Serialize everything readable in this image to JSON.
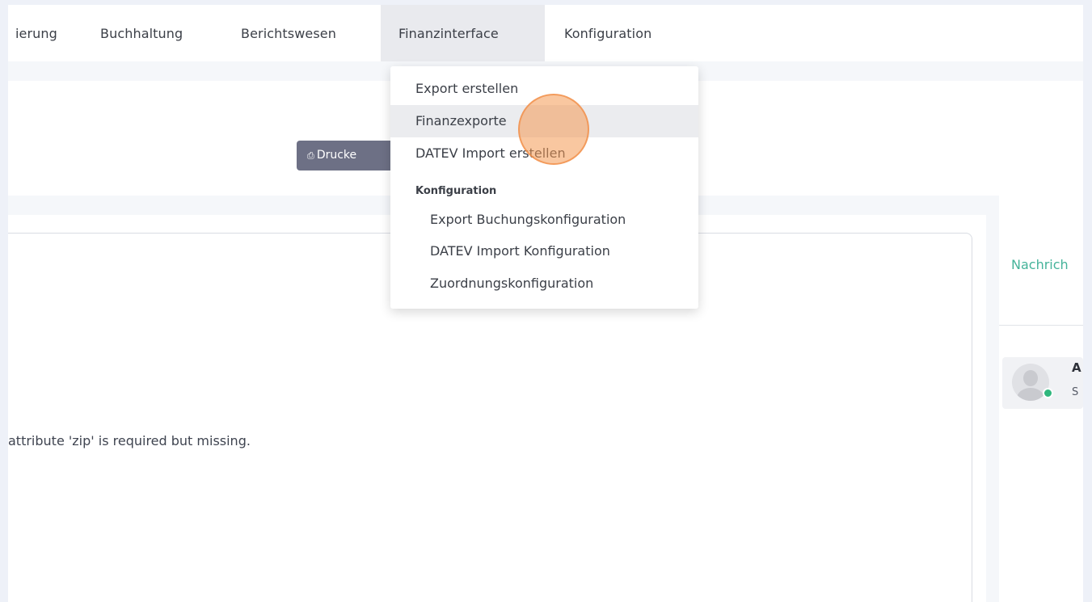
{
  "topnav": {
    "items": [
      {
        "label": "ierung"
      },
      {
        "label": "Buchhaltung"
      },
      {
        "label": "Berichtswesen"
      },
      {
        "label": "Finanzinterface"
      },
      {
        "label": "Konfiguration"
      }
    ],
    "active_index": 3
  },
  "header": {
    "print_button": {
      "label": "Drucke",
      "icon": "printer-icon"
    }
  },
  "main": {
    "error_message": "attribute 'zip' is required but missing."
  },
  "sidebar": {
    "messages_link": "Nachrich",
    "user": {
      "initial": "A",
      "subtitle": "S",
      "status": "online",
      "status_color": "#2fb77d"
    }
  },
  "dropdown": {
    "items": [
      {
        "label": "Export erstellen"
      },
      {
        "label": "Finanzexporte"
      },
      {
        "label": "DATEV Import erstellen"
      }
    ],
    "section_header": "Konfiguration",
    "sub_items": [
      {
        "label": "Export Buchungskonfiguration"
      },
      {
        "label": "DATEV Import Konfiguration"
      },
      {
        "label": "Zuordnungskonfiguration"
      }
    ],
    "hovered": "Finanzexporte"
  },
  "colors": {
    "accent_green": "#45b39a",
    "button_bg": "#6d7085",
    "cursor_highlight": "#f49952"
  }
}
